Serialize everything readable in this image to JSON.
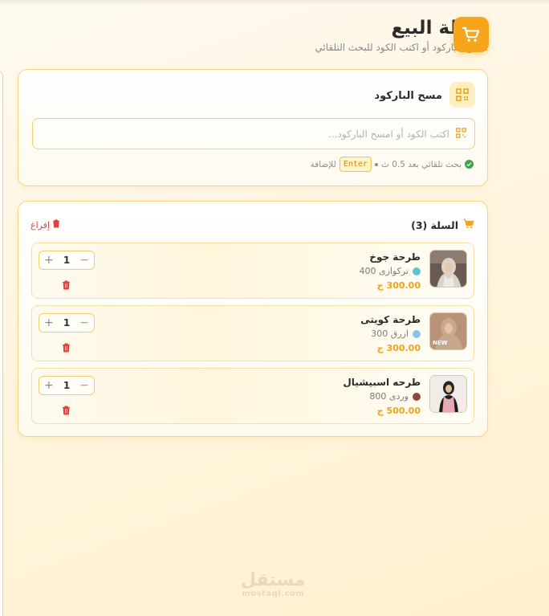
{
  "header": {
    "title": "نقطة البيع",
    "subtitle": "امسح الباركود أو اكتب الكود للبحث التلقائي",
    "icon": "cart-icon",
    "accent": "#f7a51a"
  },
  "scanner": {
    "title": "مسح الباركود",
    "icon": "qr-code-icon",
    "placeholder": "اكتب الكود أو امسح الباركود...",
    "hint_auto": "بحث تلقائي بعد 0.5 ث",
    "hint_key": "Enter",
    "hint_add": "للإضافة"
  },
  "cart": {
    "title": "السلة (3)",
    "clear_label": "إفراغ",
    "items": [
      {
        "name": "طرحة جوخ",
        "variant": "تركوازى 400",
        "variant_color": "#5fc3d4",
        "price": "300.00 ج",
        "quantity": "1"
      },
      {
        "name": "طرحة كويتى",
        "variant": "ازرق 300",
        "variant_color": "#8fc1e8",
        "price": "300.00 ج",
        "quantity": "1"
      },
      {
        "name": "طرحه اسبيشيال",
        "variant": "وردى 800",
        "variant_color": "#8c4a3c",
        "price": "500.00 ج",
        "quantity": "1"
      }
    ]
  },
  "watermark": {
    "brand_ar": "مستقل",
    "brand_en": "mostaql.com"
  },
  "colors": {
    "accent": "#f7a51a",
    "danger": "#e0413a",
    "success": "#3ea54f",
    "border": "#f6d67d"
  }
}
